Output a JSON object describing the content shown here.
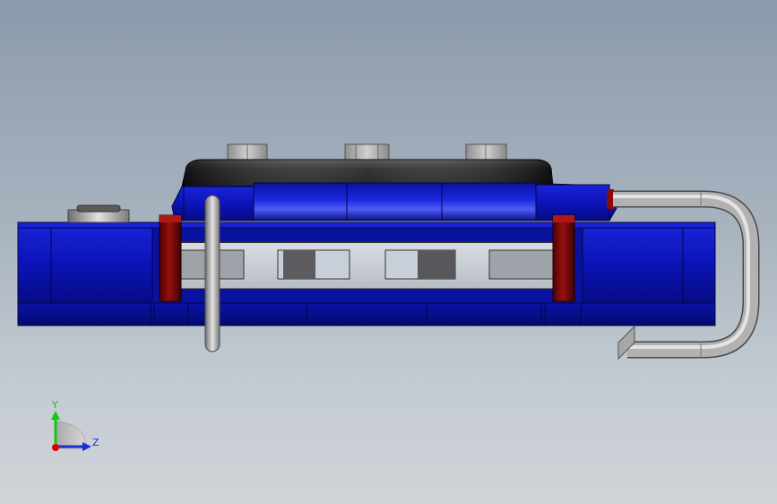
{
  "viewport": {
    "background_top": "#8b9aab",
    "background_bottom": "#cfd4d8"
  },
  "model": {
    "colors": {
      "blue_body": "#0c14b8",
      "blue_dark": "#070c7a",
      "red_pin": "#8a0a0a",
      "steel": "#b8b8b8",
      "black_cap": "#1c1c1e",
      "window_light": "#c7ccd4",
      "window_dark": "#5a5a5e"
    }
  },
  "triad": {
    "y_label": "Y",
    "z_label": "Z",
    "y_color": "#11c811",
    "z_color": "#1a2fd6",
    "x_color": "#d40000"
  }
}
